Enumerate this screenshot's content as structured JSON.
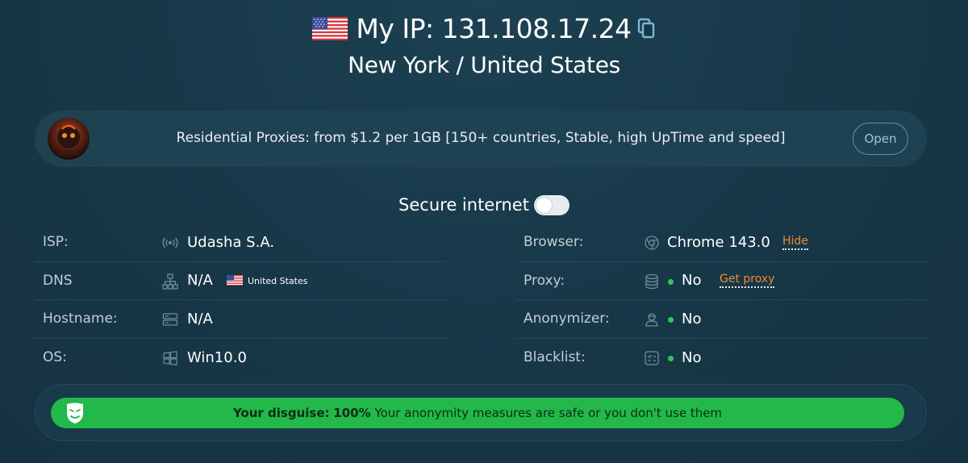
{
  "header": {
    "ip_label": "My IP:",
    "ip_address": "131.108.17.24",
    "location": "New York / United States",
    "flag_icon": "us-flag-icon",
    "copy_icon": "copy-icon"
  },
  "banner": {
    "text": "Residential Proxies: from $1.2 per 1GB [150+ countries, Stable, high UpTime and speed]",
    "button_label": "Open"
  },
  "secure": {
    "label": "Secure internet",
    "toggle_on": false
  },
  "left_rows": [
    {
      "label": "ISP:",
      "icon": "signal-icon",
      "value": "Udasha S.A."
    },
    {
      "label": "DNS",
      "icon": "network-icon",
      "value": "N/A",
      "country": "United States"
    },
    {
      "label": "Hostname:",
      "icon": "server-icon",
      "value": "N/A"
    },
    {
      "label": "OS:",
      "icon": "windows-icon",
      "value": "Win10.0"
    }
  ],
  "right_rows": [
    {
      "label": "Browser:",
      "icon": "chrome-icon",
      "value": "Chrome 143.0",
      "action": "Hide"
    },
    {
      "label": "Proxy:",
      "icon": "database-icon",
      "value": "No",
      "action": "Get proxy"
    },
    {
      "label": "Anonymizer:",
      "icon": "agent-icon",
      "value": "No"
    },
    {
      "label": "Blacklist:",
      "icon": "list-check-icon",
      "value": "No"
    }
  ],
  "disguise": {
    "label": "Your disguise:",
    "percent": "100%",
    "message": "Your anonymity measures are safe or you don't use them"
  },
  "colors": {
    "background": "#173747",
    "accent_orange": "#f08a2a",
    "success_green": "#22b84a"
  }
}
